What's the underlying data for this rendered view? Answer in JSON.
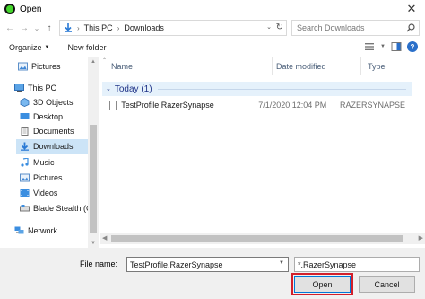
{
  "window": {
    "title": "Open",
    "close_glyph": "✕"
  },
  "nav_buttons": {
    "back": "←",
    "forward": "→",
    "recent": "⌄",
    "up": "↑"
  },
  "address": {
    "crumbs": [
      "This PC",
      "Downloads"
    ],
    "dropdown": "⌄",
    "refresh": "↻"
  },
  "search": {
    "placeholder": "Search Downloads"
  },
  "toolbar": {
    "organize": "Organize",
    "organize_caret": "▼",
    "new_folder": "New folder"
  },
  "nav_pane": {
    "items": [
      {
        "label": "Pictures",
        "icon": "pictures-icon"
      },
      {
        "label": "This PC",
        "icon": "pc-icon"
      },
      {
        "label": "3D Objects",
        "icon": "3d-objects-icon"
      },
      {
        "label": "Desktop",
        "icon": "desktop-icon"
      },
      {
        "label": "Documents",
        "icon": "documents-icon"
      },
      {
        "label": "Downloads",
        "icon": "downloads-icon",
        "selected": true
      },
      {
        "label": "Music",
        "icon": "music-icon"
      },
      {
        "label": "Pictures",
        "icon": "pictures-icon"
      },
      {
        "label": "Videos",
        "icon": "videos-icon"
      },
      {
        "label": "Blade Stealth (C:)",
        "icon": "drive-icon"
      },
      {
        "label": "Network",
        "icon": "network-icon"
      }
    ]
  },
  "columns": {
    "name": "Name",
    "date_modified": "Date modified",
    "type": "Type"
  },
  "groups": [
    {
      "label": "Today (1)",
      "caret": "⌄",
      "files": [
        {
          "name": "TestProfile.RazerSynapse",
          "date": "7/1/2020 12:04 PM",
          "type": "RAZERSYNAPSE"
        }
      ]
    }
  ],
  "footer": {
    "file_name_label": "File name:",
    "file_name_value": "TestProfile.RazerSynapse",
    "file_type": "*.RazerSynapse",
    "open_label": "Open",
    "cancel_label": "Cancel"
  },
  "colors": {
    "highlight": "#d21f2a",
    "selection": "#cce4f7",
    "group_text": "#1e3287"
  }
}
